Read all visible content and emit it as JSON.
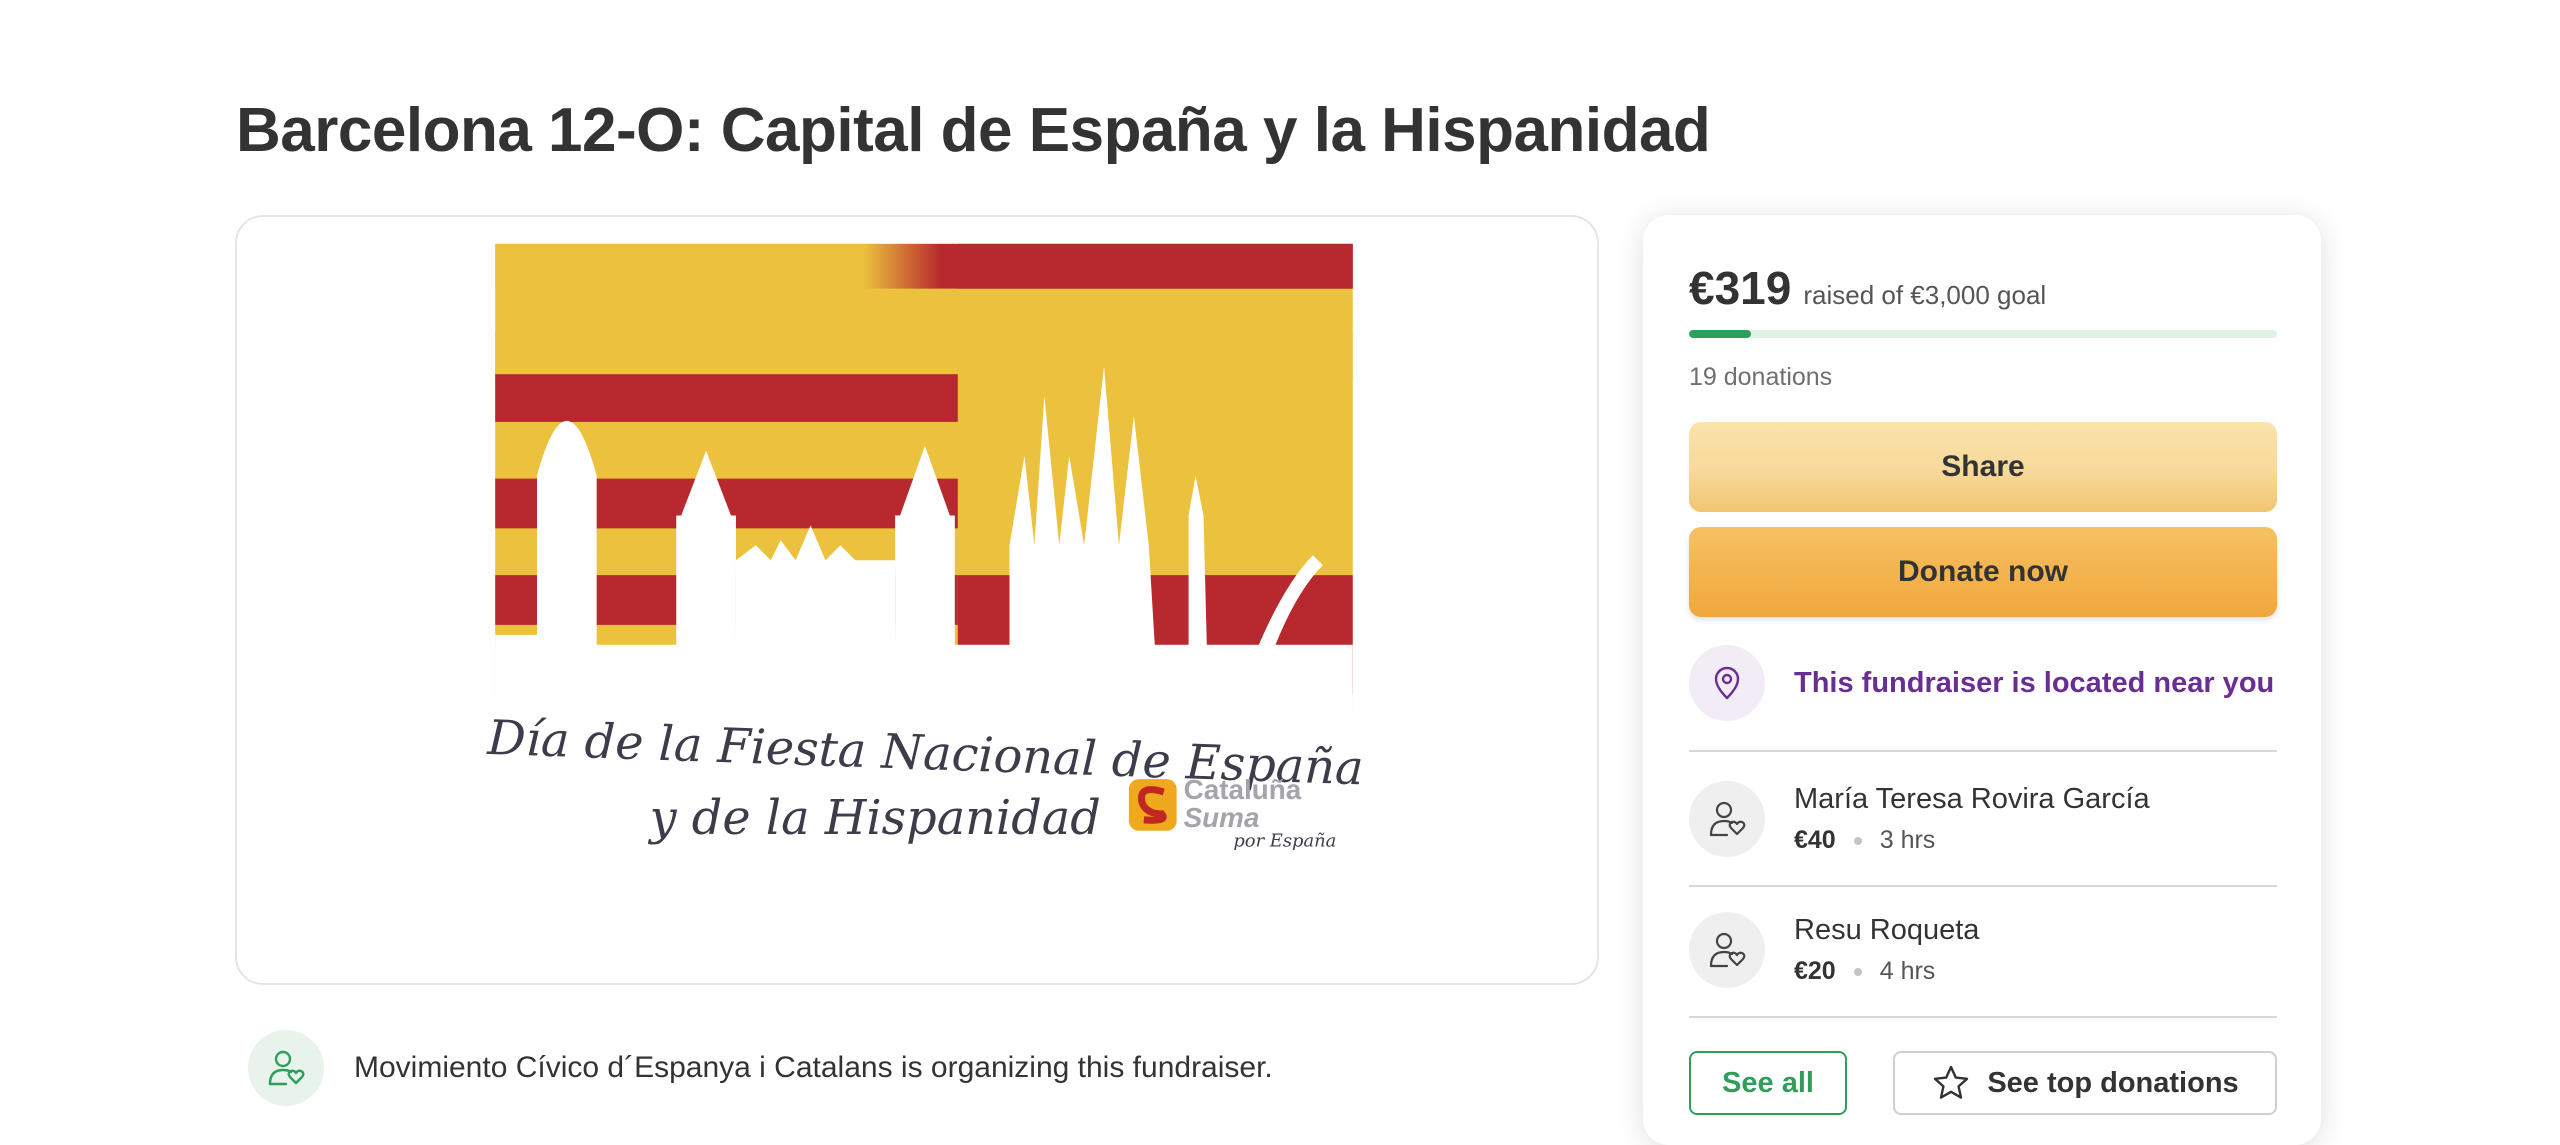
{
  "page": {
    "title": "Barcelona 12-O: Capital de España y la Hispanidad"
  },
  "campaign_image": {
    "caption_line1": "Día de la Fiesta Nacional de España",
    "caption_line2": "y de la Hispanidad",
    "logo_line1": "Cataluña",
    "logo_line2": "Suma",
    "logo_line3": "por España",
    "flag_colors": {
      "red": "#b8282f",
      "yellow": "#ecc13e"
    }
  },
  "organizer": {
    "text": "Movimiento Cívico d´Espanya i Catalans is organizing this fundraiser.",
    "icon": "person-heart-icon"
  },
  "sidebar": {
    "raised": "€319",
    "goal_text": "raised of €3,000 goal",
    "progress_fraction": 0.106,
    "donation_count": "19 donations",
    "share_label": "Share",
    "donate_label": "Donate now",
    "location_text": "This fundraiser is located near you",
    "location_icon": "map-pin-icon",
    "donations": [
      {
        "name": "María Teresa Rovira García",
        "amount": "€40",
        "time": "3 hrs"
      },
      {
        "name": "Resu Roqueta",
        "amount": "€20",
        "time": "4 hrs"
      }
    ],
    "see_all_label": "See all",
    "top_donations_label": "See top donations",
    "top_donations_icon": "star-icon"
  },
  "colors": {
    "brand_green": "#2f9e5b",
    "location_purple": "#6a2e93",
    "donate_orange": "#f0a73d",
    "share_yellow": "#f7d99a"
  }
}
